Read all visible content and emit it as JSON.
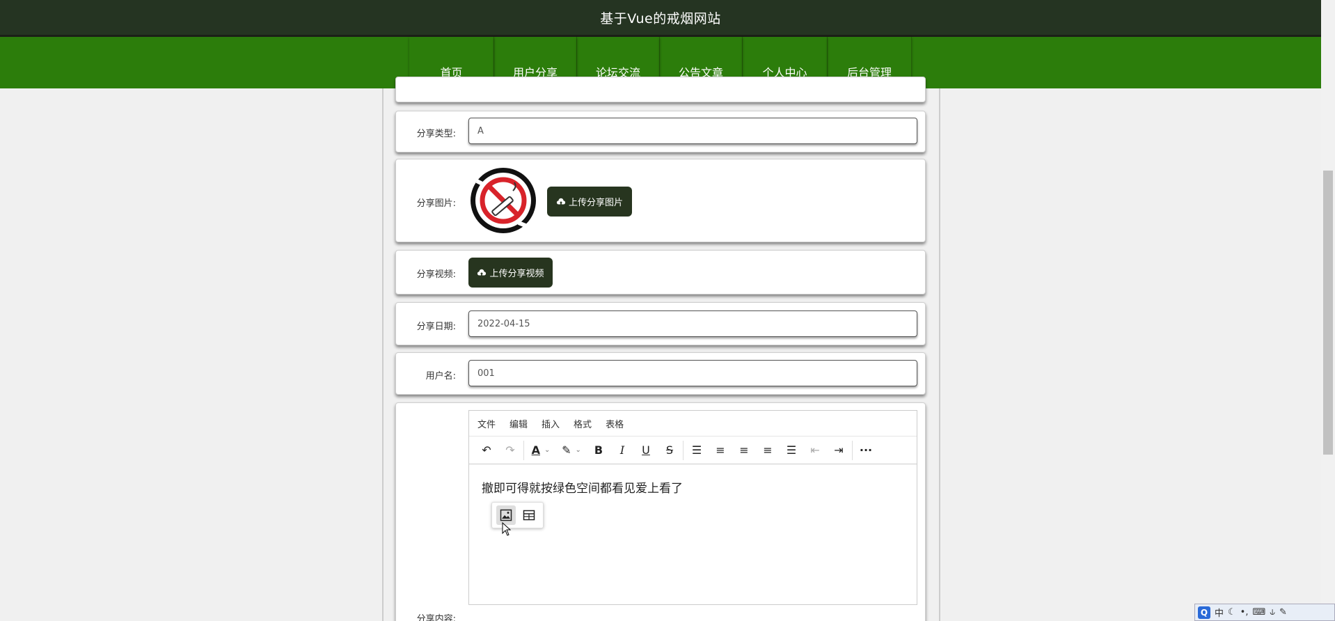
{
  "header": {
    "site_title": "基于Vue的戒烟网站"
  },
  "nav": {
    "items": [
      {
        "label": "首页"
      },
      {
        "label": "用户分享"
      },
      {
        "label": "论坛交流"
      },
      {
        "label": "公告文章"
      },
      {
        "label": "个人中心"
      },
      {
        "label": "后台管理"
      }
    ]
  },
  "form": {
    "type": {
      "label": "分享类型:",
      "value": "A"
    },
    "image": {
      "label": "分享图片:",
      "button": "上传分享图片"
    },
    "video": {
      "label": "分享视频:",
      "button": "上传分享视频"
    },
    "date": {
      "label": "分享日期:",
      "value": "2022-04-15"
    },
    "username": {
      "label": "用户名:",
      "value": "001"
    },
    "content": {
      "label": "分享内容:"
    }
  },
  "editor": {
    "menus": [
      "文件",
      "编辑",
      "插入",
      "格式",
      "表格"
    ],
    "text": "撤即可得就按绿色空间都看见爱上看了"
  },
  "ime": {
    "logo": "Q",
    "mode": "中"
  },
  "colors": {
    "topbar": "#253422",
    "navbar": "#2c7d0b",
    "button": "#27351f"
  }
}
